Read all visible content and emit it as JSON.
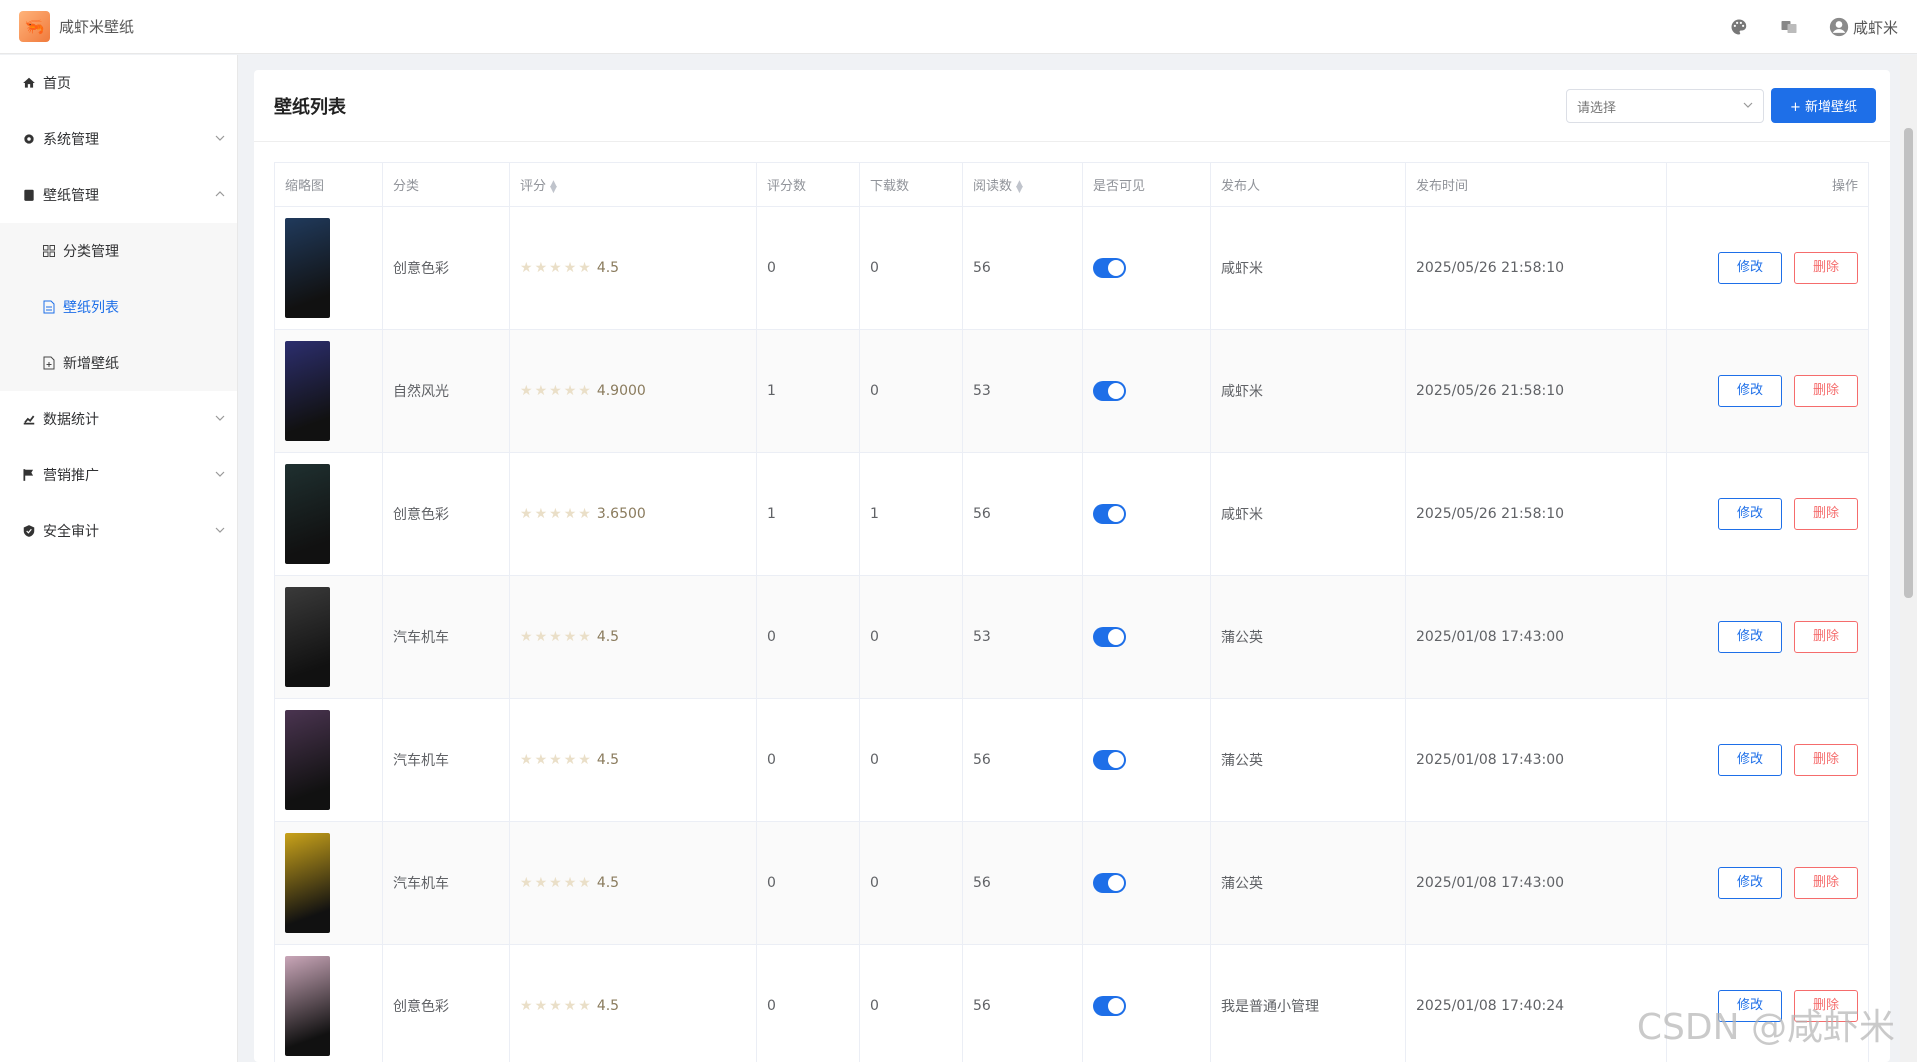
{
  "header": {
    "app_title": "咸虾米壁纸",
    "user_name": "咸虾米"
  },
  "sidebar": {
    "items": [
      {
        "label": "首页",
        "icon": "home-icon"
      },
      {
        "label": "系统管理",
        "icon": "gear-icon"
      },
      {
        "label": "壁纸管理",
        "icon": "clipboard-icon"
      },
      {
        "label": "分类管理",
        "icon": "grid-icon"
      },
      {
        "label": "壁纸列表",
        "icon": "document-icon"
      },
      {
        "label": "新增壁纸",
        "icon": "document-add-icon"
      },
      {
        "label": "数据统计",
        "icon": "chart-icon"
      },
      {
        "label": "营销推广",
        "icon": "flag-icon"
      },
      {
        "label": "安全审计",
        "icon": "shield-icon"
      }
    ]
  },
  "main": {
    "title": "壁纸列表",
    "select_placeholder": "请选择",
    "add_button": "+ 新增壁纸",
    "columns": [
      "缩略图",
      "分类",
      "评分",
      "评分数",
      "下载数",
      "阅读数",
      "是否可见",
      "发布人",
      "发布时间",
      "操作"
    ],
    "rows": [
      {
        "category": "创意色彩",
        "rating": "4.5",
        "rating_count": "0",
        "downloads": "0",
        "views": "56",
        "publisher": "咸虾米",
        "time": "2025/05/26 21:58:10",
        "thumb": "#203a5c"
      },
      {
        "category": "自然风光",
        "rating": "4.9000",
        "rating_count": "1",
        "downloads": "0",
        "views": "53",
        "publisher": "咸虾米",
        "time": "2025/05/26 21:58:10",
        "thumb": "#2c2e6e"
      },
      {
        "category": "创意色彩",
        "rating": "3.6500",
        "rating_count": "1",
        "downloads": "1",
        "views": "56",
        "publisher": "咸虾米",
        "time": "2025/05/26 21:58:10",
        "thumb": "#1f3030"
      },
      {
        "category": "汽车机车",
        "rating": "4.5",
        "rating_count": "0",
        "downloads": "0",
        "views": "53",
        "publisher": "蒲公英",
        "time": "2025/01/08 17:43:00",
        "thumb": "#3a3a3a"
      },
      {
        "category": "汽车机车",
        "rating": "4.5",
        "rating_count": "0",
        "downloads": "0",
        "views": "56",
        "publisher": "蒲公英",
        "time": "2025/01/08 17:43:00",
        "thumb": "#4a3450"
      },
      {
        "category": "汽车机车",
        "rating": "4.5",
        "rating_count": "0",
        "downloads": "0",
        "views": "56",
        "publisher": "蒲公英",
        "time": "2025/01/08 17:43:00",
        "thumb": "#c9a21a"
      },
      {
        "category": "创意色彩",
        "rating": "4.5",
        "rating_count": "0",
        "downloads": "0",
        "views": "56",
        "publisher": "我是普通小管理",
        "time": "2025/01/08 17:40:24",
        "thumb": "#c9a6b8"
      }
    ],
    "edit_label": "修改",
    "delete_label": "删除"
  },
  "watermark": "CSDN @咸虾米",
  "colors": {
    "primary": "#1e6fe8",
    "danger": "#f56c6c"
  }
}
